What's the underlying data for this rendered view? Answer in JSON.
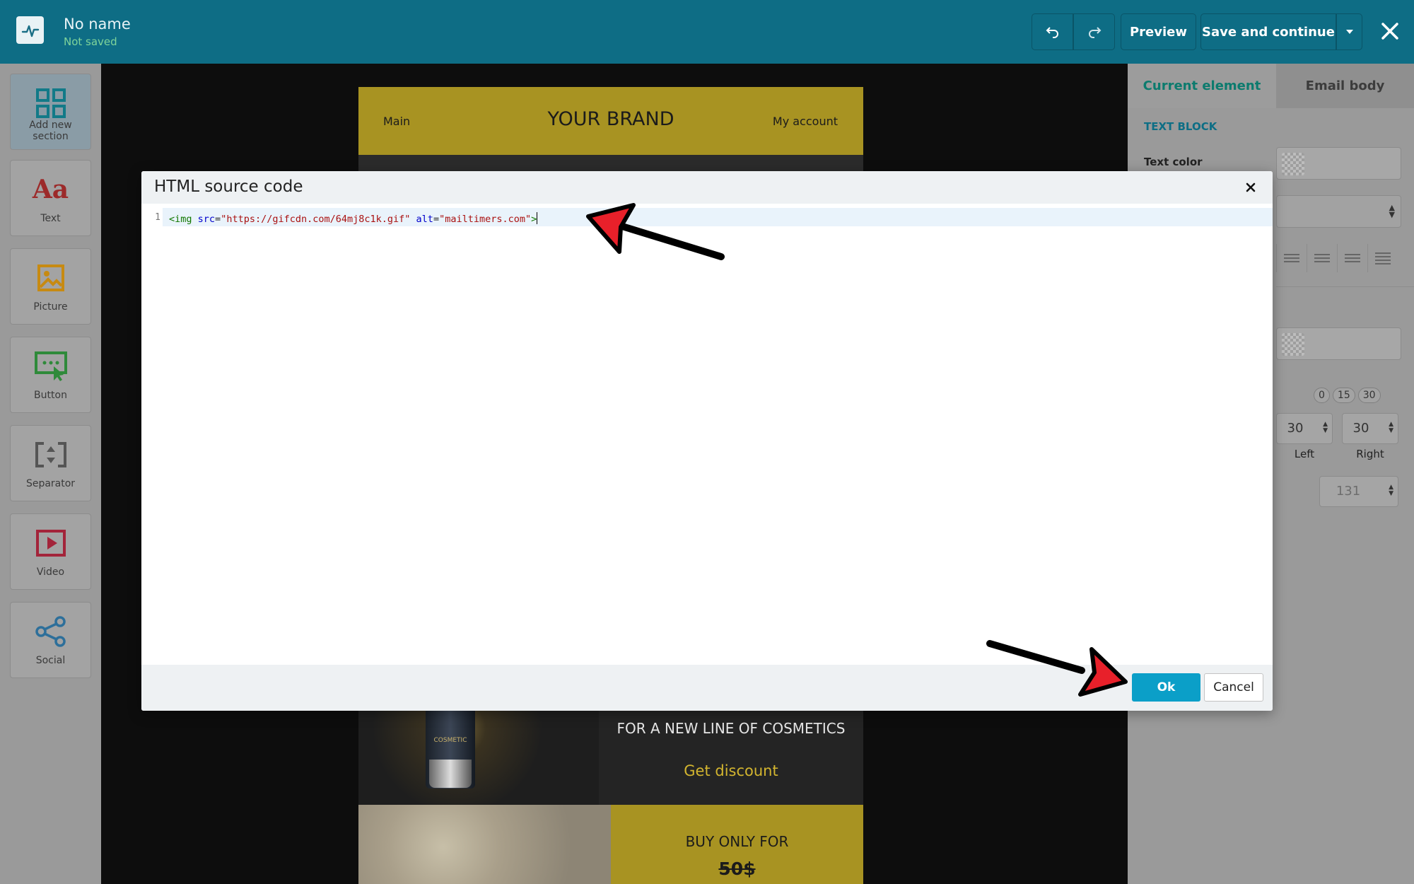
{
  "topbar": {
    "doc_name": "No name",
    "doc_status": "Not saved",
    "logo_icon": "pulse-icon",
    "undo_icon": "undo-icon",
    "redo_icon": "redo-icon",
    "preview_label": "Preview",
    "save_label": "Save and continue",
    "save_dropdown_icon": "chevron-down-icon",
    "close_icon": "close-icon"
  },
  "sidebar": {
    "items": [
      {
        "label": "Add new section",
        "icon": "grid-icon"
      },
      {
        "label": "Text",
        "icon": "text-icon"
      },
      {
        "label": "Picture",
        "icon": "picture-icon"
      },
      {
        "label": "Button",
        "icon": "button-icon"
      },
      {
        "label": "Separator",
        "icon": "separator-icon"
      },
      {
        "label": "Video",
        "icon": "video-icon"
      },
      {
        "label": "Social",
        "icon": "share-icon"
      }
    ]
  },
  "email": {
    "nav_main": "Main",
    "brand": "YOUR BRAND",
    "nav_account": "My account",
    "promo_title": "FOR A NEW LINE OF COSMETICS",
    "promo_link": "Get discount",
    "bottle_label": "COSMETIC",
    "offer_label": "BUY ONLY FOR",
    "offer_price": "50$"
  },
  "right_panel": {
    "tab_current": "Current element",
    "tab_body": "Email body",
    "section_title": "TEXT BLOCK",
    "text_color_label": "Text color",
    "presets": [
      "0",
      "15",
      "30"
    ],
    "padding_left_value": "30",
    "padding_left_label": "Left",
    "padding_right_value": "30",
    "padding_right_label": "Right",
    "height_value": "131"
  },
  "modal": {
    "title": "HTML source code",
    "close_icon": "close-icon",
    "line_number": "1",
    "code": {
      "t1": "<img",
      "a1": "src",
      "eq1": "=",
      "s1": "\"https://gifcdn.com/64mj8c1k.gif\"",
      "a2": "alt",
      "eq2": "=",
      "s2": "\"mailtimers.com\"",
      "t2": ">"
    },
    "ok_label": "Ok",
    "cancel_label": "Cancel"
  },
  "colors": {
    "topbar": "#0e6d85",
    "brand_gold": "#a89322",
    "ok_button": "#0b9fc8",
    "annotation_arrow": "#e8202a"
  }
}
